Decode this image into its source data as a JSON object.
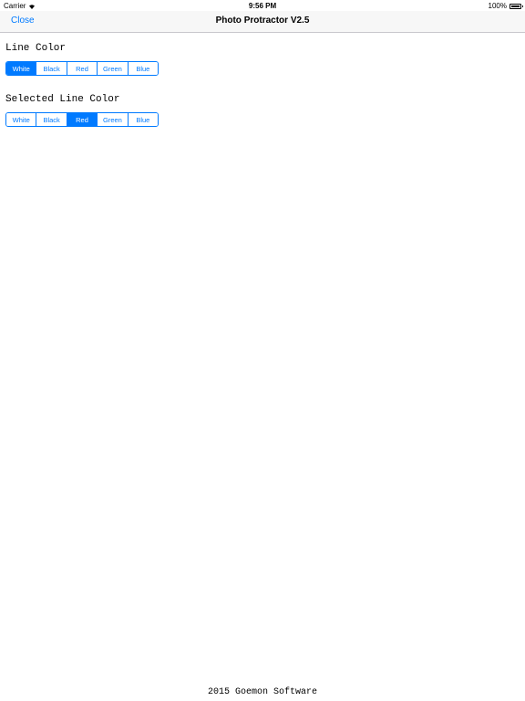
{
  "status_bar": {
    "carrier": "Carrier",
    "time": "9:56 PM",
    "battery": "100%",
    "battery_level": 1.0
  },
  "nav": {
    "close_label": "Close",
    "title": "Photo Protractor V2.5"
  },
  "line_color": {
    "label": "Line Color",
    "options": [
      "White",
      "Black",
      "Red",
      "Green",
      "Blue"
    ],
    "selected": "White"
  },
  "selected_line_color": {
    "label": "Selected Line Color",
    "options": [
      "White",
      "Black",
      "Red",
      "Green",
      "Blue"
    ],
    "selected": "Red"
  },
  "footer": {
    "text": "2015 Goemon Software"
  },
  "colors": {
    "accent": "#007aff",
    "nav_background": "#f7f7f7",
    "separator": "#c8c7cc"
  }
}
